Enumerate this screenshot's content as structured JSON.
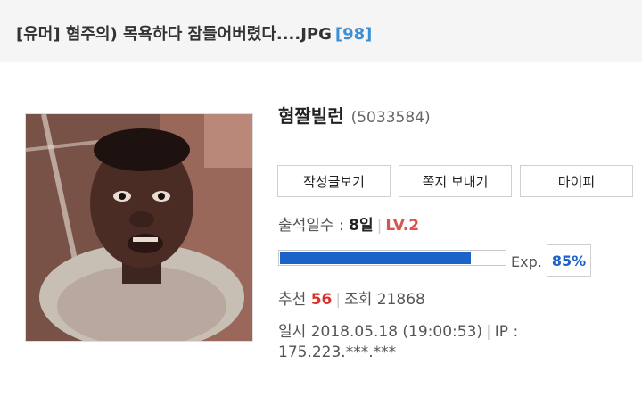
{
  "post": {
    "title": "[유머] 혐주의) 목욕하다 잠들어버렸다....JPG",
    "comment_count": "[98]"
  },
  "author": {
    "nickname": "혐짤빌런",
    "user_id": "(5033584)"
  },
  "buttons": {
    "view_posts": "작성글보기",
    "send_message": "쪽지 보내기",
    "mypi": "마이피"
  },
  "attendance": {
    "label": "출석일수 :",
    "value": "8일",
    "level": "LV.2"
  },
  "experience": {
    "label": "Exp.",
    "percent_text": "85%",
    "fill_fraction": 0.85,
    "bar_color": "#1b63c9"
  },
  "stats": {
    "recommend_label": "추천",
    "recommend_value": "56",
    "views_label": "조회",
    "views_value": "21868"
  },
  "meta": {
    "date_text": "일시 2018.05.18 (19:00:53)",
    "ip_label": "IP :",
    "ip_value": "175.223.***.***"
  },
  "colors": {
    "accent_blue": "#3a8fd6",
    "level_red": "#d9534f"
  }
}
